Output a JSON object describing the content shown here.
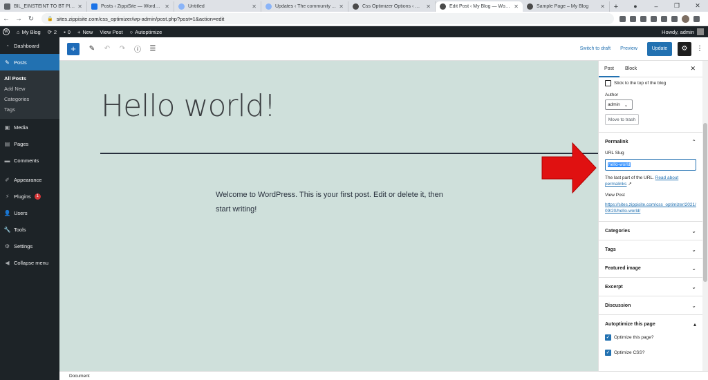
{
  "browser": {
    "tabs": [
      {
        "label": "BIL_EINSTEINT TO BT Plugin ...",
        "active": false
      },
      {
        "label": "Posts ‹ ZippiSite — WordPress",
        "active": false
      },
      {
        "label": "Untitled",
        "active": false
      },
      {
        "label": "Updates ‹ The community ...",
        "active": false
      },
      {
        "label": "Css Optimizer Options ‹ My Blog",
        "active": false
      },
      {
        "label": "Edit Post ‹ My Blog — WordPress",
        "active": true
      },
      {
        "label": "Sample Page – My Blog",
        "active": false
      }
    ],
    "url": "sites.zippisite.com/css_optimizer/wp-admin/post.php?post=1&action=edit"
  },
  "adminbar": {
    "site": "My Blog",
    "updates": "2",
    "comments": "0",
    "new": "New",
    "view_post": "View Post",
    "autoptimize": "Autoptimize",
    "howdy": "Howdy, admin"
  },
  "menu": {
    "dashboard": "Dashboard",
    "posts": "Posts",
    "sub": [
      "All Posts",
      "Add New",
      "Categories",
      "Tags"
    ],
    "media": "Media",
    "pages": "Pages",
    "comments": "Comments",
    "appearance": "Appearance",
    "plugins": "Plugins",
    "plugins_badge": "1",
    "users": "Users",
    "tools": "Tools",
    "settings": "Settings",
    "collapse": "Collapse menu"
  },
  "header": {
    "switch_draft": "Switch to draft",
    "preview": "Preview",
    "update": "Update"
  },
  "editor": {
    "title": "Hello world!",
    "body": "Welcome to WordPress. This is your first post. Edit or delete it, then start writing!"
  },
  "sidebar": {
    "tab_post": "Post",
    "tab_block": "Block",
    "sticky": "Stick to the top of the blog",
    "author_label": "Author",
    "author_value": "admin",
    "trash": "Move to trash",
    "permalink": "Permalink",
    "url_slug": "URL Slug",
    "slug_value": "hello-world",
    "help_text": "The last part of the URL.",
    "help_link": "Read about permalinks",
    "view_post": "View Post",
    "permalink_url": "https://sites.zippisite.com/css_optimizer/2021/09/20/hello-world/",
    "categories": "Categories",
    "tags": "Tags",
    "featured": "Featured image",
    "excerpt": "Excerpt",
    "discussion": "Discussion",
    "autoptimize": "Autoptimize this page",
    "opt_page": "Optimize this page?",
    "opt_css": "Optimize CSS?"
  },
  "footer": {
    "label": "Document"
  },
  "colors": {
    "accent": "#2271b1",
    "adminbar": "#1d2327",
    "canvas": "#cfe0db",
    "arrow": "#e01111"
  }
}
